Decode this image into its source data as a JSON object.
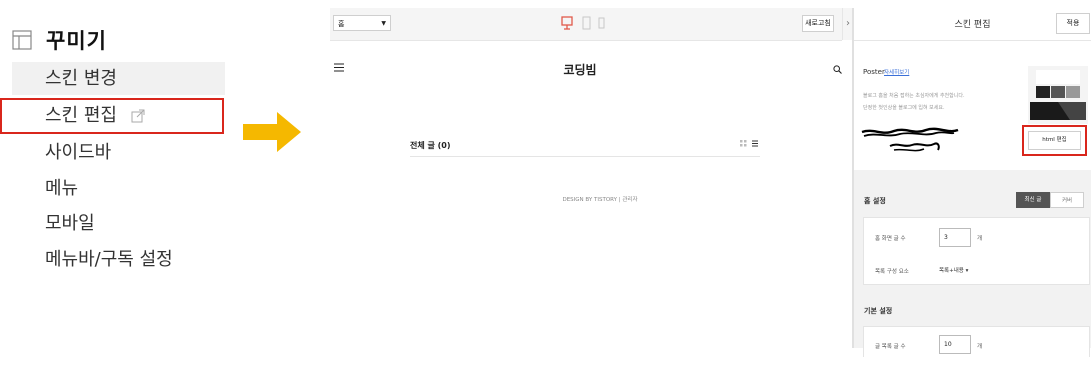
{
  "menu": {
    "title": "꾸미기",
    "items": [
      {
        "label": "스킨 변경"
      },
      {
        "label": "스킨 편집"
      },
      {
        "label": "사이드바"
      },
      {
        "label": "메뉴"
      },
      {
        "label": "모바일"
      },
      {
        "label": "메뉴바/구독 설정"
      }
    ]
  },
  "colors": {
    "highlight": "#d9261c",
    "arrow": "#f5b800",
    "device_active": "#e05a4a"
  },
  "editor": {
    "toolbar": {
      "page_select_value": "홈",
      "refresh_label": "새로고침",
      "collapse_label": "›"
    },
    "preview": {
      "blog_title": "코딩빔",
      "post_count": "전체 글 (0)",
      "footer": "DESIGN BY TISTORY  |  관리자"
    },
    "panel": {
      "title": "스킨 편집",
      "apply_label": "적용",
      "skin_name": "Poster",
      "skin_link": "자세히보기",
      "skin_desc_1": "블로그 홈을 처음 접하는 초심자에게 추천합니다.",
      "skin_desc_2": "단정한 첫인상을 블로그에 입혀 보세요.",
      "html_edit_label": "html 편집",
      "home_settings": {
        "label": "홈 설정",
        "tabs": [
          {
            "label": "최신 글"
          },
          {
            "label": "커버"
          }
        ],
        "posts_label": "홈 화면 글 수",
        "posts_value": "3",
        "posts_unit": "개",
        "list_label": "목록 구성 요소",
        "list_value": "목록+내용 ▾"
      },
      "basic_settings": {
        "label": "기본 설정",
        "posts_label": "글 목록 글 수",
        "posts_value": "10",
        "posts_unit": "개"
      }
    }
  }
}
